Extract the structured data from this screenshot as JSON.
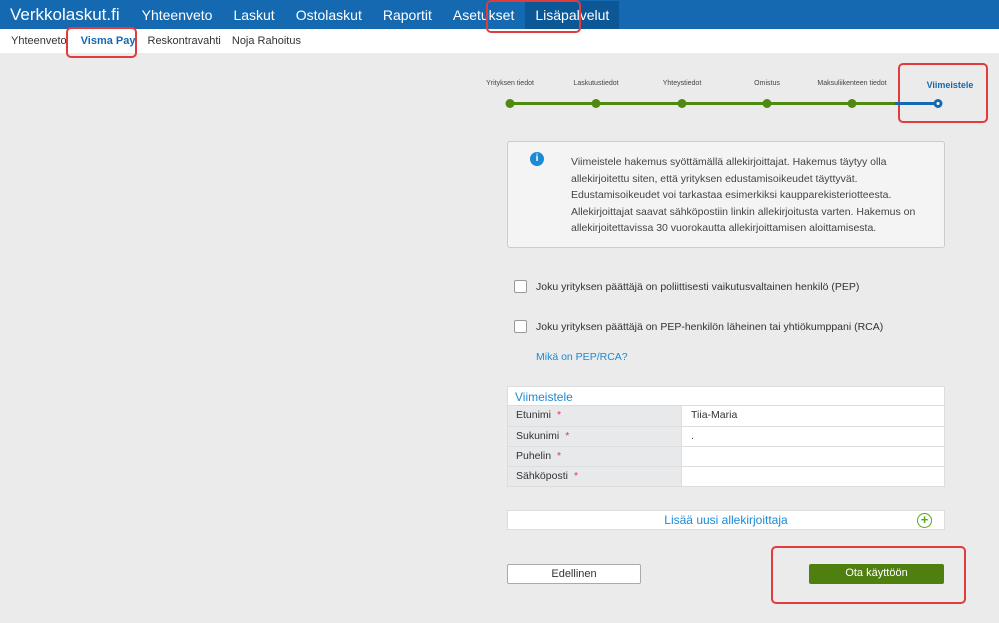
{
  "topbar": {
    "brand": "Verkkolaskut.fi",
    "nav": [
      "Yhteenveto",
      "Laskut",
      "Ostolaskut",
      "Raportit",
      "Asetukset",
      "Lisäpalvelut"
    ]
  },
  "subnav": [
    "Yhteenveto",
    "Visma Pay",
    "Reskontravahti",
    "Noja Rahoitus"
  ],
  "steps": [
    "Yrityksen tiedot",
    "Laskutustiedot",
    "Yhteystiedot",
    "Omistus",
    "Maksuliikenteen tiedot",
    "Viimeistele"
  ],
  "info": {
    "text": "Viimeistele hakemus syöttämällä allekirjoittajat. Hakemus täytyy olla allekirjoitettu siten, että yrityksen edustamisoikeudet täyttyvät. Edustamisoikeudet voi tarkastaa esimerkiksi kaupparekisteriotteesta. Allekirjoittajat saavat sähköpostiin linkin allekirjoitusta varten. Hakemus on allekirjoitettavissa 30 vuorokautta allekirjoittamisen aloittamisesta."
  },
  "checks": {
    "pep": "Joku yrityksen päättäjä on poliittisesti vaikutusvaltainen henkilö (PEP)",
    "rca": "Joku yrityksen päättäjä on PEP-henkilön läheinen tai yhtiökumppani (RCA)",
    "link": "Mikä on PEP/RCA?"
  },
  "form": {
    "title": "Viimeistele",
    "required": "*",
    "rows": [
      {
        "label": "Etunimi",
        "value": "Tiia-Maria"
      },
      {
        "label": "Sukunimi",
        "value": "."
      },
      {
        "label": "Puhelin",
        "value": ""
      },
      {
        "label": "Sähköposti",
        "value": ""
      }
    ]
  },
  "add_signer": "Lisää uusi allekirjoittaja",
  "buttons": {
    "prev": "Edellinen",
    "submit": "Ota käyttöön"
  }
}
